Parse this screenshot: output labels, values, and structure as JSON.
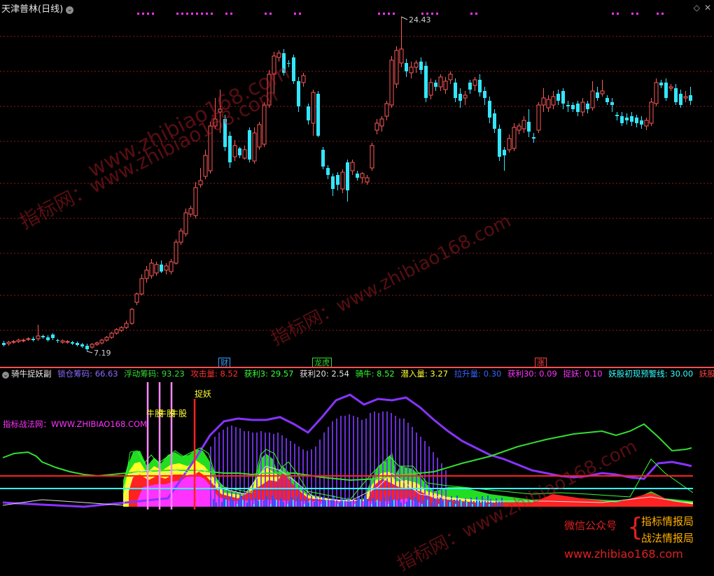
{
  "window": {
    "title": "天津普林(日线)",
    "collapse_icon": "circle-chevron-down-icon",
    "right_icons": [
      "diamond-icon",
      "close-icon"
    ]
  },
  "main_chart": {
    "high_label": "24.43",
    "low_label": "7.19",
    "event_tags": [
      {
        "text": "财",
        "color": "#3aa0ff"
      },
      {
        "text": "龙虎",
        "color": "#33dd33"
      },
      {
        "text": "涨",
        "color": "#ff4040"
      }
    ],
    "colors": {
      "up": "#ff5a5a",
      "down": "#33e6ff",
      "grid": "#8b1a1a",
      "signal_dots": "#ff33ff"
    }
  },
  "indicator": {
    "name": "骑牛捉妖副",
    "collapse_icon": "circle-chevron-down-icon",
    "values": [
      {
        "label": "锁仓筹码:",
        "value": "66.63",
        "color": "#8a6bff"
      },
      {
        "label": "浮动筹码:",
        "value": "93.23",
        "color": "#33dd33"
      },
      {
        "label": "攻击量:",
        "value": "8.52",
        "color": "#ff3030"
      },
      {
        "label": "获利3:",
        "value": "29.57",
        "color": "#33ff33"
      },
      {
        "label": "获利20:",
        "value": "2.54",
        "color": "#e0e0e0"
      },
      {
        "label": "骑牛:",
        "value": "8.52",
        "color": "#33ff33"
      },
      {
        "label": "潜入量:",
        "value": "3.27",
        "color": "#ffff33"
      },
      {
        "label": "拉升量:",
        "value": "0.30",
        "color": "#3366ff"
      },
      {
        "label": "获利30:",
        "value": "0.09",
        "color": "#ff33ff"
      },
      {
        "label": "捉妖:",
        "value": "0.10",
        "color": "#ff33ff"
      },
      {
        "label": "妖股初现预警线:",
        "value": "30.00",
        "color": "#33ffff"
      },
      {
        "label": "妖股极端预警线:",
        "value": "",
        "color": "#ff4040"
      }
    ],
    "site_label": "指标战法网：WWW.ZHIBIAO168.COM",
    "signal_labels": {
      "niu": "牛股",
      "niu2": "牛股",
      "niu3": "牛股",
      "zhuoyao": "捉妖"
    }
  },
  "watermarks": [
    "www.zhibiao168.com",
    "指标网：www.zhibiao168.com",
    "指标网：www.zhibiao168.com",
    "指标网：www.zhibiao168.com"
  ],
  "promo": {
    "wechat": "微信公众号",
    "line1": "指标情报局",
    "line2": "战法情报局",
    "url": "www.zhibiao168.com"
  }
}
